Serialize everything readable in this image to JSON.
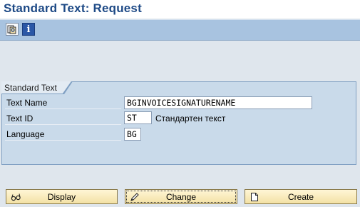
{
  "window": {
    "title": "Standard Text: Request"
  },
  "toolbar": {
    "buttons": [
      {
        "name": "other-object-icon"
      },
      {
        "name": "info-icon",
        "glyph": "i"
      }
    ]
  },
  "group": {
    "title": "Standard Text",
    "fields": {
      "text_name": {
        "label": "Text Name",
        "value": "BGINVOICESIGNATURENAME"
      },
      "text_id": {
        "label": "Text ID",
        "value": "ST",
        "description": "Стандартен текст"
      },
      "language": {
        "label": "Language",
        "value": "BG"
      }
    }
  },
  "actions": {
    "display": "Display",
    "change": "Change",
    "create": "Create"
  },
  "colors": {
    "title": "#1e4a86",
    "toolbar": "#a8c3e0",
    "group_bg": "#c9daea",
    "button_bg": "#f3e1a5"
  }
}
